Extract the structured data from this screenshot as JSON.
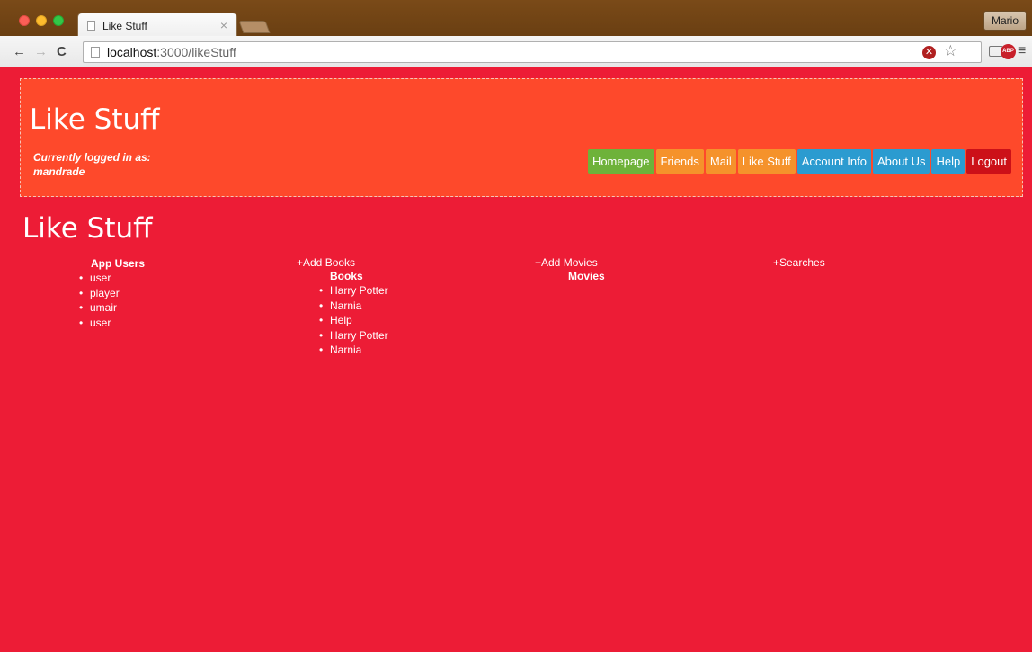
{
  "browser": {
    "tab_title": "Like Stuff",
    "tab_close": "×",
    "profile_name": "Mario",
    "url_host": "localhost",
    "url_path": ":3000/likeStuff",
    "nav_back": "←",
    "nav_forward": "→",
    "nav_reload": "C"
  },
  "header": {
    "site_title": "Like Stuff",
    "logged_in_label": "Currently logged in as:",
    "username": "mandrade"
  },
  "nav": {
    "items": [
      {
        "label": "Homepage",
        "color": "#6eb23a"
      },
      {
        "label": "Friends",
        "color": "#f5922b"
      },
      {
        "label": "Mail",
        "color": "#f5922b"
      },
      {
        "label": "Like Stuff",
        "color": "#f5922b"
      },
      {
        "label": "Account Info",
        "color": "#2b9bd0"
      },
      {
        "label": "About Us",
        "color": "#2b9bd0"
      },
      {
        "label": "Help",
        "color": "#2b9bd0"
      },
      {
        "label": "Logout",
        "color": "#cc1018"
      }
    ]
  },
  "page": {
    "title": "Like Stuff",
    "app_users": {
      "heading": "App Users",
      "items": [
        "user",
        "player",
        "umair",
        "user"
      ]
    },
    "books": {
      "add_link": "+Add Books",
      "heading": "Books",
      "items": [
        "Harry Potter",
        "Narnia",
        "Help",
        "Harry Potter",
        "Narnia"
      ]
    },
    "movies": {
      "add_link": "+Add Movies",
      "heading": "Movies",
      "items": []
    },
    "searches": {
      "add_link": "+Searches"
    }
  },
  "colors": {
    "page_background": "#ed1c36",
    "header_background": "#fe492b"
  }
}
